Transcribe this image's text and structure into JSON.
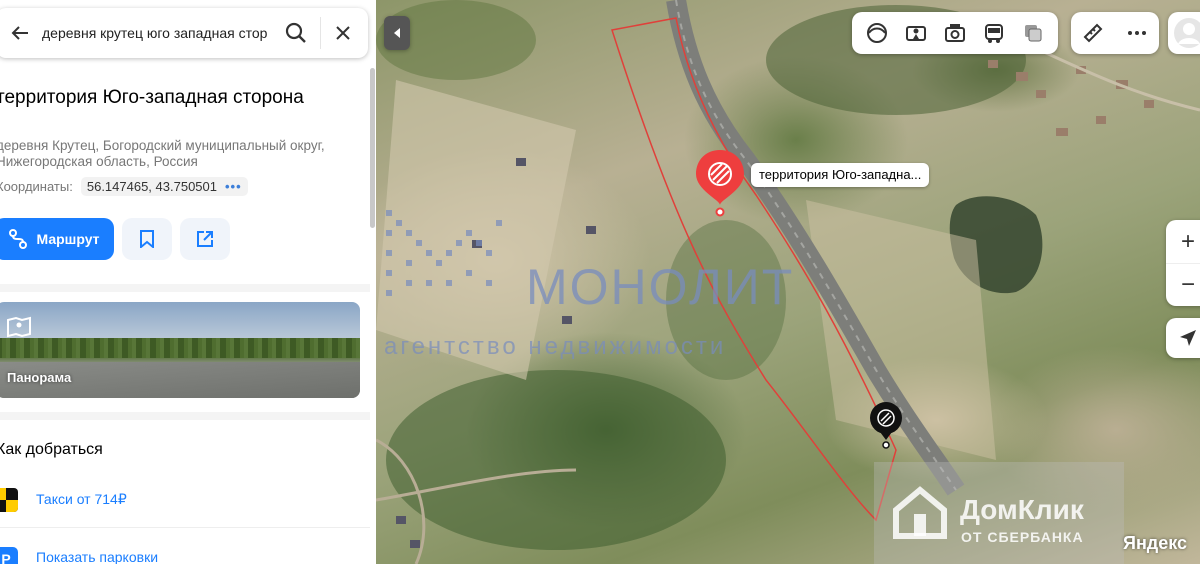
{
  "search": {
    "query": "деревня крутец юго западная стор"
  },
  "place": {
    "title": "территория Юго-западная сторона",
    "address": "деревня Крутец, Богородский муниципальный округ, Нижегородская область, Россия",
    "coords_label": "Координаты:",
    "coords_value": "56.147465, 43.750501"
  },
  "actions": {
    "route_label": "Маршрут"
  },
  "panorama": {
    "label": "Панорама"
  },
  "directions": {
    "title": "Как добраться",
    "taxi_label": "Такси от 714₽",
    "parking_label": "Показать парковки",
    "parking_icon_letter": "P"
  },
  "map": {
    "pin_label": "территория Юго-западна...",
    "pin_color": "#ee3e3e",
    "boundary_color": "#e0403a",
    "watermark_monolit": "МОНОЛИТ",
    "watermark_agency": "агентство недвижимости",
    "watermark_domclick": "ДомКлик",
    "watermark_sber": "ОТ СБЕРБАНКА",
    "provider_logo": "Яндекс",
    "zoom_in": "+",
    "zoom_out": "−"
  },
  "accent_color": "#1a7eff"
}
